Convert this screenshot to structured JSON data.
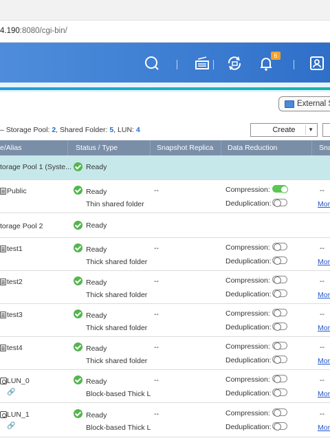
{
  "browser": {
    "url_host": "4.190",
    "url_rest": ":8080/cgi-bin/"
  },
  "header": {
    "notification_count": "6",
    "icons": [
      "search-icon",
      "tasks-icon",
      "sync-icon",
      "bell-icon",
      "user-icon"
    ]
  },
  "toolbar": {
    "external_label": "External S",
    "create_label": "Create"
  },
  "summary": {
    "prefix": "– Storage Pool: ",
    "pool_count": "2",
    "folder_label": ", Shared Folder: ",
    "folder_count": "5",
    "lun_label": ", LUN: ",
    "lun_count": "4"
  },
  "table": {
    "headers": {
      "name": "e/Alias",
      "status": "Status / Type",
      "snapshot": "Snapshot Replica",
      "reduction": "Data Reduction",
      "extra": "Sna"
    },
    "pools": [
      {
        "name": "torage Pool 1 (Syste...",
        "status": "Ready"
      },
      {
        "name": "torage Pool 2",
        "status": "Ready"
      }
    ],
    "items": [
      {
        "name": "Public",
        "status": "Ready",
        "type": "Thin shared folder",
        "snapshot": "--",
        "compression_label": "Compression:",
        "compression_on": true,
        "dedup_label": "Deduplication:",
        "dedup_on": false,
        "extra": "--",
        "more": "Mor"
      },
      {
        "name": "test1",
        "status": "Ready",
        "type": "Thick shared folder",
        "snapshot": "--",
        "compression_label": "Compression:",
        "compression_on": false,
        "dedup_label": "Deduplication:",
        "dedup_on": false,
        "extra": "--",
        "more": "Mor"
      },
      {
        "name": "test2",
        "status": "Ready",
        "type": "Thick shared folder",
        "snapshot": "--",
        "compression_label": "Compression:",
        "compression_on": false,
        "dedup_label": "Deduplication:",
        "dedup_on": false,
        "extra": "--",
        "more": "Mor"
      },
      {
        "name": "test3",
        "status": "Ready",
        "type": "Thick shared folder",
        "snapshot": "--",
        "compression_label": "Compression:",
        "compression_on": false,
        "dedup_label": "Deduplication:",
        "dedup_on": false,
        "extra": "--",
        "more": "Mor"
      },
      {
        "name": "test4",
        "status": "Ready",
        "type": "Thick shared folder",
        "snapshot": "--",
        "compression_label": "Compression:",
        "compression_on": false,
        "dedup_label": "Deduplication:",
        "dedup_on": false,
        "extra": "--",
        "more": "Mor"
      },
      {
        "name": "LUN_0",
        "status": "Ready",
        "type": "Block-based Thick L",
        "snapshot": "--",
        "compression_label": "Compression:",
        "compression_on": false,
        "dedup_label": "Deduplication:",
        "dedup_on": false,
        "extra": "--",
        "more": "Mor"
      },
      {
        "name": "LUN_1",
        "status": "Ready",
        "type": "Block-based Thick L",
        "snapshot": "--",
        "compression_label": "Compression:",
        "compression_on": false,
        "dedup_label": "Deduplication:",
        "dedup_on": false,
        "extra": "--",
        "more": "Mor"
      }
    ]
  }
}
